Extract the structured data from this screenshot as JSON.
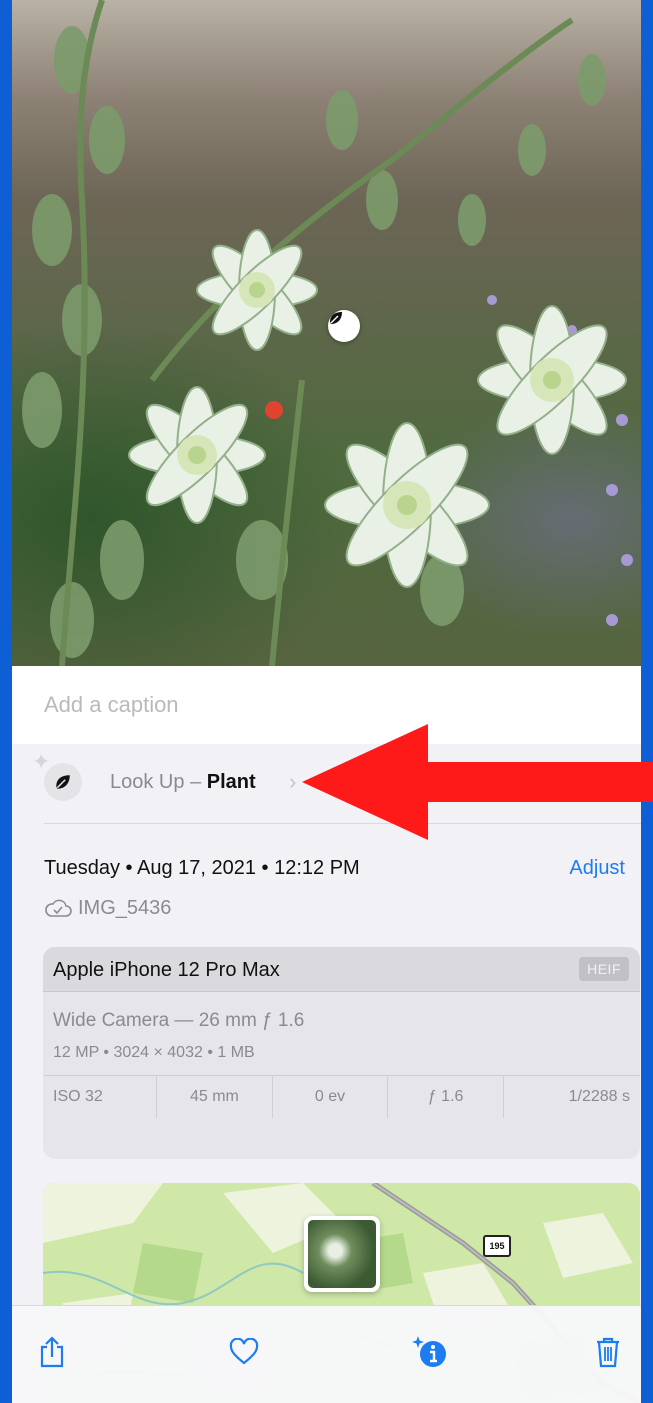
{
  "photo": {
    "lookup_badge_icon": "leaf-icon"
  },
  "caption": {
    "placeholder": "Add a caption"
  },
  "lookup": {
    "prefix": "Look Up – ",
    "subject": "Plant",
    "chevron": "›",
    "icon": "leaf-icon"
  },
  "info": {
    "date": "Tuesday • Aug 17, 2021 • 12:12 PM",
    "adjust_label": "Adjust",
    "filename": "IMG_5436",
    "cloud_icon": "icloud-check-icon"
  },
  "camera": {
    "device": "Apple iPhone 12 Pro Max",
    "format": "HEIF",
    "lens": "Wide Camera — 26 mm ƒ 1.6",
    "specs": "12 MP  •  3024 × 4032  •  1 MB",
    "exif": [
      "ISO 32",
      "45 mm",
      "0 ev",
      "ƒ 1.6",
      "1/2288 s"
    ]
  },
  "map": {
    "route_label": "195"
  },
  "toolbar": {
    "share_icon": "share-icon",
    "favorite_icon": "heart-icon",
    "info_icon": "info-sparkle-icon",
    "delete_icon": "trash-icon"
  },
  "colors": {
    "accent": "#1c7cf0",
    "frame": "#0e5fd6",
    "arrow": "#ff1a1a"
  }
}
